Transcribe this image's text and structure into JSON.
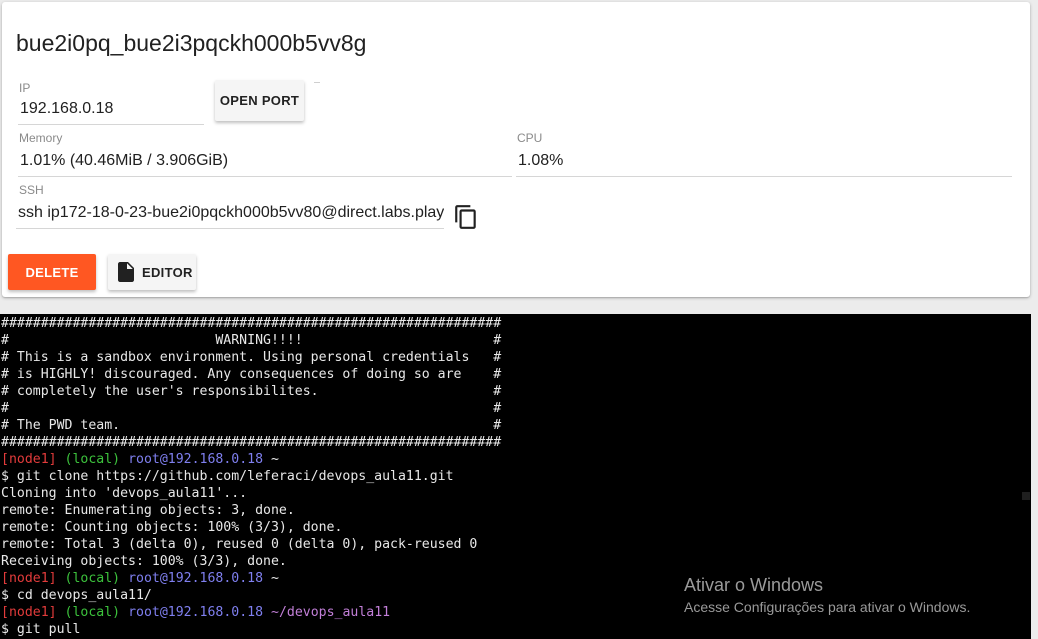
{
  "instance": {
    "title": "bue2i0pq_bue2i3pqckh000b5vv8g",
    "ip_label": "IP",
    "ip_value": "192.168.0.18",
    "open_port_label": "OPEN PORT",
    "memory_label": "Memory",
    "memory_value": "1.01% (40.46MiB / 3.906GiB)",
    "cpu_label": "CPU",
    "cpu_value": "1.08%",
    "ssh_label": "SSH",
    "ssh_value": "ssh ip172-18-0-23-bue2i0pqckh000b5vv80@direct.labs.play",
    "delete_label": "DELETE",
    "editor_label": "EDITOR"
  },
  "icons": {
    "copy": "copy-icon",
    "editor": "file-icon"
  },
  "colors": {
    "delete_button": "#ff5722",
    "terminal_bg": "#000000",
    "prompt_node": "#e23b3b",
    "prompt_local": "#3cc23c",
    "prompt_user": "#7f7fef",
    "prompt_path": "#c27fd8"
  },
  "terminal": {
    "banner": [
      "###############################################################",
      "#                          WARNING!!!!                        #",
      "# This is a sandbox environment. Using personal credentials   #",
      "# is HIGHLY! discouraged. Any consequences of doing so are    #",
      "# completely the user's responsibilites.                      #",
      "#                                                             #",
      "# The PWD team.                                               #",
      "###############################################################"
    ],
    "prompt1": {
      "node": "[node1]",
      "local": "(local)",
      "user": "root@192.168.0.18",
      "path": "~"
    },
    "cmd1": "$ git clone https://github.com/leferaci/devops_aula11.git",
    "output": [
      "Cloning into 'devops_aula11'...",
      "remote: Enumerating objects: 3, done.",
      "remote: Counting objects: 100% (3/3), done.",
      "remote: Total 3 (delta 0), reused 0 (delta 0), pack-reused 0",
      "Receiving objects: 100% (3/3), done."
    ],
    "prompt2": {
      "node": "[node1]",
      "local": "(local)",
      "user": "root@192.168.0.18",
      "path": "~"
    },
    "cmd2": "$ cd devops_aula11/",
    "prompt3": {
      "node": "[node1]",
      "local": "(local)",
      "user": "root@192.168.0.18",
      "path": "~/devops_aula11"
    },
    "cmd3": "$ git pull"
  },
  "watermark": {
    "title": "Ativar o Windows",
    "subtitle": "Acesse Configurações para ativar o Windows."
  }
}
